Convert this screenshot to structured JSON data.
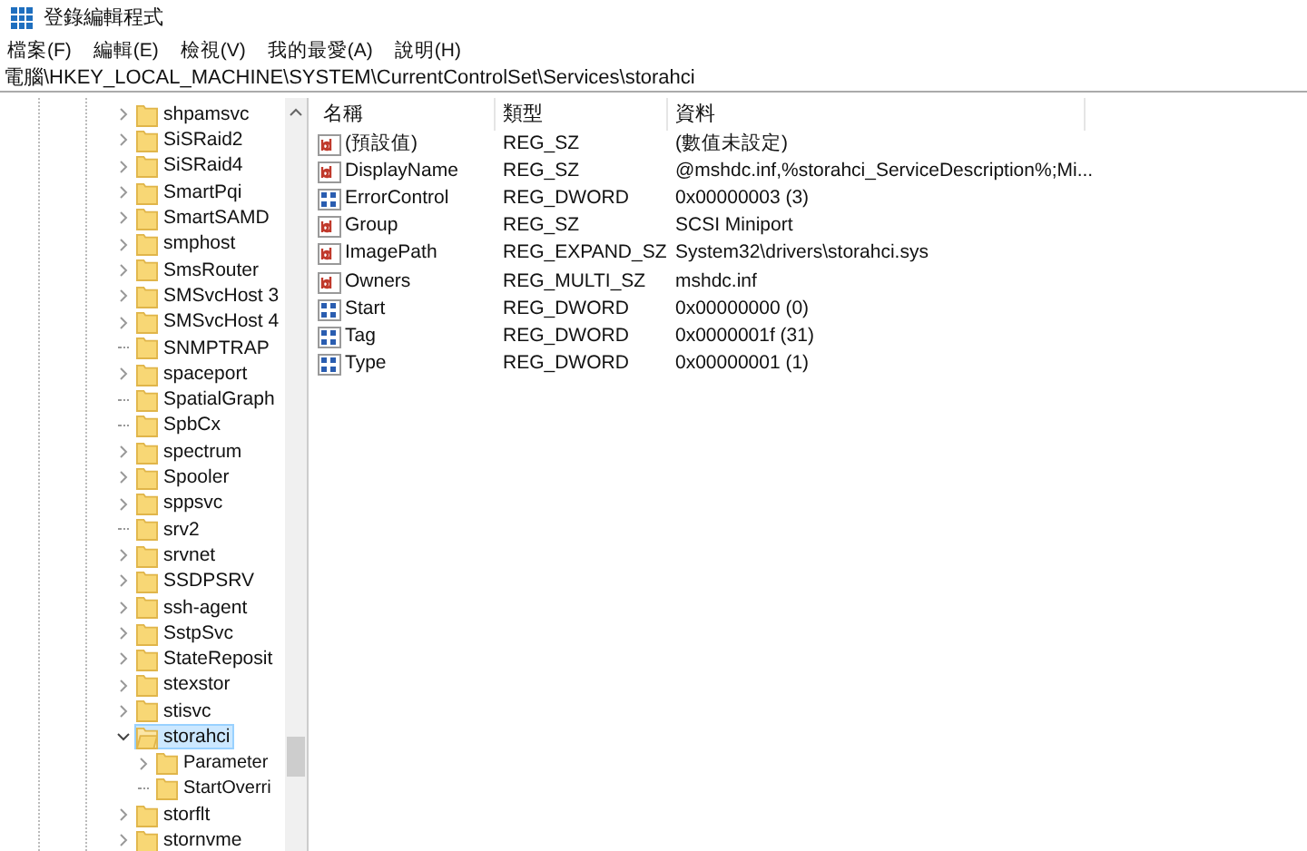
{
  "window": {
    "title": "登錄編輯程式"
  },
  "menu": [
    "檔案(F)",
    "編輯(E)",
    "檢視(V)",
    "我的最愛(A)",
    "說明(H)"
  ],
  "address": "電腦\\HKEY_LOCAL_MACHINE\\SYSTEM\\CurrentControlSet\\Services\\storahci",
  "tree": [
    {
      "label": "shpamsvc",
      "expandable": true,
      "expanded": false,
      "selected": false
    },
    {
      "label": "SiSRaid2",
      "expandable": true,
      "expanded": false,
      "selected": false
    },
    {
      "label": "SiSRaid4",
      "expandable": true,
      "expanded": false,
      "selected": false
    },
    {
      "label": "SmartPqi",
      "expandable": true,
      "expanded": false,
      "selected": false
    },
    {
      "label": "SmartSAMD",
      "expandable": true,
      "expanded": false,
      "selected": false
    },
    {
      "label": "smphost",
      "expandable": true,
      "expanded": false,
      "selected": false
    },
    {
      "label": "SmsRouter",
      "expandable": true,
      "expanded": false,
      "selected": false
    },
    {
      "label": "SMSvcHost 3",
      "expandable": true,
      "expanded": false,
      "selected": false
    },
    {
      "label": "SMSvcHost 4",
      "expandable": true,
      "expanded": false,
      "selected": false
    },
    {
      "label": "SNMPTRAP",
      "expandable": false,
      "selected": false
    },
    {
      "label": "spaceport",
      "expandable": true,
      "expanded": false,
      "selected": false
    },
    {
      "label": "SpatialGraph",
      "expandable": false,
      "selected": false
    },
    {
      "label": "SpbCx",
      "expandable": false,
      "selected": false
    },
    {
      "label": "spectrum",
      "expandable": true,
      "expanded": false,
      "selected": false
    },
    {
      "label": "Spooler",
      "expandable": true,
      "expanded": false,
      "selected": false
    },
    {
      "label": "sppsvc",
      "expandable": true,
      "expanded": false,
      "selected": false
    },
    {
      "label": "srv2",
      "expandable": false,
      "selected": false
    },
    {
      "label": "srvnet",
      "expandable": true,
      "expanded": false,
      "selected": false
    },
    {
      "label": "SSDPSRV",
      "expandable": true,
      "expanded": false,
      "selected": false
    },
    {
      "label": "ssh-agent",
      "expandable": true,
      "expanded": false,
      "selected": false
    },
    {
      "label": "SstpSvc",
      "expandable": true,
      "expanded": false,
      "selected": false
    },
    {
      "label": "StateReposit",
      "expandable": true,
      "expanded": false,
      "selected": false
    },
    {
      "label": "stexstor",
      "expandable": true,
      "expanded": false,
      "selected": false
    },
    {
      "label": "stisvc",
      "expandable": true,
      "expanded": false,
      "selected": false
    },
    {
      "label": "storahci",
      "expandable": true,
      "expanded": true,
      "selected": true,
      "children": [
        {
          "label": "Parameter",
          "expandable": true,
          "expanded": false,
          "selected": false
        },
        {
          "label": "StartOverri",
          "expandable": false,
          "selected": false
        }
      ]
    },
    {
      "label": "storflt",
      "expandable": true,
      "expanded": false,
      "selected": false
    },
    {
      "label": "stornvme",
      "expandable": true,
      "expanded": false,
      "selected": false
    }
  ],
  "columns": [
    "名稱",
    "類型",
    "資料"
  ],
  "values": [
    {
      "kind": "string",
      "name": "(預設值)",
      "type": "REG_SZ",
      "data": "(數值未設定)"
    },
    {
      "kind": "string",
      "name": "DisplayName",
      "type": "REG_SZ",
      "data": "@mshdc.inf,%storahci_ServiceDescription%;Mi..."
    },
    {
      "kind": "dword",
      "name": "ErrorControl",
      "type": "REG_DWORD",
      "data": "0x00000003 (3)"
    },
    {
      "kind": "string",
      "name": "Group",
      "type": "REG_SZ",
      "data": "SCSI Miniport"
    },
    {
      "kind": "string",
      "name": "ImagePath",
      "type": "REG_EXPAND_SZ",
      "data": "System32\\drivers\\storahci.sys"
    },
    {
      "kind": "string",
      "name": "Owners",
      "type": "REG_MULTI_SZ",
      "data": "mshdc.inf"
    },
    {
      "kind": "dword",
      "name": "Start",
      "type": "REG_DWORD",
      "data": "0x00000000 (0)"
    },
    {
      "kind": "dword",
      "name": "Tag",
      "type": "REG_DWORD",
      "data": "0x0000001f (31)"
    },
    {
      "kind": "dword",
      "name": "Type",
      "type": "REG_DWORD",
      "data": "0x00000001 (1)"
    }
  ]
}
